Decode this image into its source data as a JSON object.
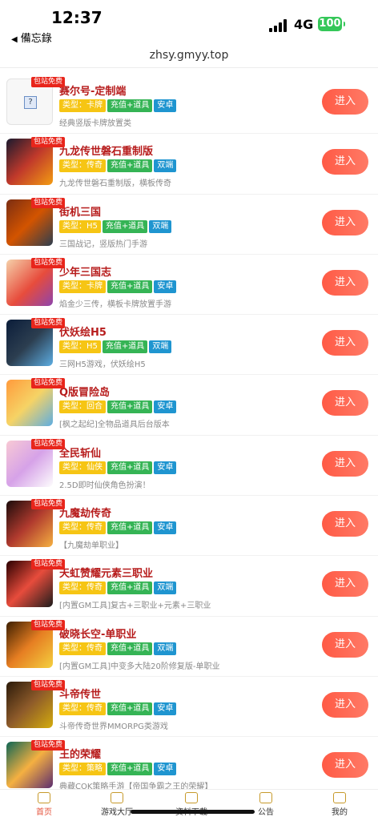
{
  "status": {
    "time": "12:37",
    "back_label": "備忘錄",
    "network": "4G",
    "battery": "100"
  },
  "browser": {
    "url": "zhsy.gmyy.top"
  },
  "colors": {
    "accent": "#ff5a45",
    "type_tag": "#f6c514",
    "feature_tag": "#35b455",
    "platform_tag": "#1f95d0",
    "badge": "#e8251b"
  },
  "list": {
    "enter_label": "进入",
    "badge_label": "包站免费",
    "items": [
      {
        "title": "赛尔号-定制端",
        "type": "类型：卡牌",
        "feature": "充值+道具",
        "platform": "安卓",
        "desc": "经典竖版卡牌放置类"
      },
      {
        "title": "九龙传世磐石重制版",
        "type": "类型：传奇",
        "feature": "充值+道具",
        "platform": "双端",
        "desc": "九龙传世磐石重制版，横板传奇"
      },
      {
        "title": "街机三国",
        "type": "类型：H5",
        "feature": "充值+道具",
        "platform": "双端",
        "desc": "三国战记，竖版热门手游"
      },
      {
        "title": "少年三国志",
        "type": "类型：卡牌",
        "feature": "充值+道具",
        "platform": "安卓",
        "desc": "焰金少三传，横板卡牌放置手游"
      },
      {
        "title": "伏妖绘H5",
        "type": "类型：H5",
        "feature": "充值+道具",
        "platform": "双端",
        "desc": "三网H5游戏，伏妖绘H5"
      },
      {
        "title": "Q版冒险岛",
        "type": "类型：回合",
        "feature": "充值+道具",
        "platform": "安卓",
        "desc": "[枫之起纪]全物品道具后台版本"
      },
      {
        "title": "全民斩仙",
        "type": "类型：仙侠",
        "feature": "充值+道具",
        "platform": "安卓",
        "desc": "2.5D即时仙侠角色扮演！"
      },
      {
        "title": "九魔劫传奇",
        "type": "类型：传奇",
        "feature": "充值+道具",
        "platform": "安卓",
        "desc": "【九魔劫单职业】"
      },
      {
        "title": "天虹赞耀元素三职业",
        "type": "类型：传奇",
        "feature": "充值+道具",
        "platform": "双端",
        "desc": "[内置GM工具]复古+三职业+元素+三职业"
      },
      {
        "title": "破晓长空-单职业",
        "type": "类型：传奇",
        "feature": "充值+道具",
        "platform": "双端",
        "desc": "[内置GM工具]中变多大陆20阶修复版-单职业"
      },
      {
        "title": "斗帝传世",
        "type": "类型：传奇",
        "feature": "充值+道具",
        "platform": "安卓",
        "desc": "斗帝传奇世界MMORPG类游戏"
      },
      {
        "title": "王的荣耀",
        "type": "类型：策略",
        "feature": "充值+道具",
        "platform": "安卓",
        "desc": "典藏COK策略手游【帝国争霸之王的荣耀】"
      }
    ]
  },
  "tabbar": {
    "tabs": [
      {
        "label": "首页",
        "icon": "home-icon"
      },
      {
        "label": "游戏大厅",
        "icon": "gamepad-icon"
      },
      {
        "label": "资料下载",
        "icon": "folder-icon"
      },
      {
        "label": "公告",
        "icon": "chat-icon"
      },
      {
        "label": "我的",
        "icon": "user-icon"
      }
    ]
  }
}
